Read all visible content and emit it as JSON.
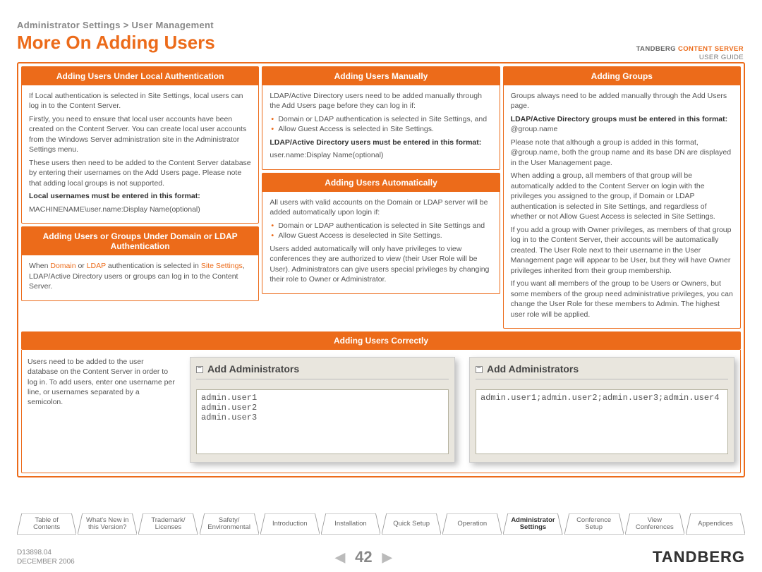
{
  "header": {
    "breadcrumb": "Administrator Settings > User Management",
    "title": "More On Adding Users",
    "product_line1_a": "TANDBERG ",
    "product_line1_b": "CONTENT SERVER",
    "product_line2": "USER GUIDE"
  },
  "col1": {
    "mod1": {
      "title": "Adding Users Under Local Authentication",
      "p1": "If Local authentication is selected in Site Settings, local users can log in to the Content Server.",
      "p2": "Firstly, you need to ensure that local user accounts have been created on the Content Server. You can create local user accounts from the Windows Server administration site in the Administrator Settings menu.",
      "p3": "These users then need to be added to the Content Server database by entering their usernames on the Add Users page. Please note that adding local groups is not supported.",
      "b1": "Local usernames must be entered in this format:",
      "p4": "MACHINENAME\\user.name:Display Name(optional)"
    },
    "mod2": {
      "title": "Adding Users or Groups Under Domain or LDAP Authentication",
      "p1a": "When ",
      "p1b": "Domain",
      "p1c": " or ",
      "p1d": "LDAP",
      "p1e": " authentication is selected in ",
      "p1f": "Site Settings",
      "p1g": ", LDAP/Active Directory users or groups can log in to the Content Server."
    }
  },
  "col2": {
    "mod1": {
      "title": "Adding Users Manually",
      "p1": "LDAP/Active Directory users need to be added manually through the Add Users page before they can log in if:",
      "li1": "Domain or LDAP authentication is selected in Site Settings, and",
      "li2": "Allow Guest Access is selected in Site Settings.",
      "b1": "LDAP/Active Directory users must be entered in this format:",
      "p2": "user.name:Display Name(optional)"
    },
    "mod2": {
      "title": "Adding Users Automatically",
      "p1": "All users with valid accounts on the Domain or LDAP server will be added automatically upon login if:",
      "li1": "Domain or LDAP authentication is selected in Site Settings and",
      "li2": "Allow Guest Access is deselected in Site Settings.",
      "p2": "Users added automatically will only have privileges to view conferences they are authorized to view (their User Role will be User). Administrators can give users special privileges by changing their role to Owner or Administrator."
    }
  },
  "col3": {
    "mod1": {
      "title": "Adding Groups",
      "p1": "Groups always need to be added manually through the Add Users page.",
      "b1": "LDAP/Active Directory groups must be entered in this format:",
      "p1b": "@group.name",
      "p2": "Please note that although a group is added in this format, @group.name, both the group name and its base DN are displayed in the User Management page.",
      "p3": "When adding a group, all members of that group will be automatically added to the Content Server on login with the privileges you assigned to the group, if Domain or LDAP authentication is selected in Site Settings, and regardless of whether or not Allow Guest Access is selected in Site Settings.",
      "p4": "If you add a group with Owner privileges, as members of that group log in to the Content Server, their accounts will be automatically created. The User Role next to their username in the User Management page will appear to be User, but they will have Owner privileges inherited from their group membership.",
      "p5": "If you want all members of the group to be Users or Owners, but some members of the group need administrative privileges, you can change the User Role for these members to Admin. The highest user role will be applied."
    }
  },
  "correctly": {
    "title": "Adding Users Correctly",
    "note": "Users need to be added to the user database on the Content Server in order to log in. To add users, enter one username per line, or usernames separated by a semicolon.",
    "shot1_title": "Add Administrators",
    "shot1_text": "admin.user1\nadmin.user2\nadmin.user3",
    "shot2_title": "Add Administrators",
    "shot2_text": "admin.user1;admin.user2;admin.user3;admin.user4"
  },
  "tabs": [
    "Table of Contents",
    "What's New in this Version?",
    "Trademark/ Licenses",
    "Safety/ Environmental",
    "Introduction",
    "Installation",
    "Quick Setup",
    "Operation",
    "Administrator Settings",
    "Conference Setup",
    "View Conferences",
    "Appendices"
  ],
  "tabs_active_index": 8,
  "footer": {
    "doc": "D13898.04",
    "date": "DECEMBER 2006",
    "page": "42",
    "brand": "TANDBERG"
  }
}
